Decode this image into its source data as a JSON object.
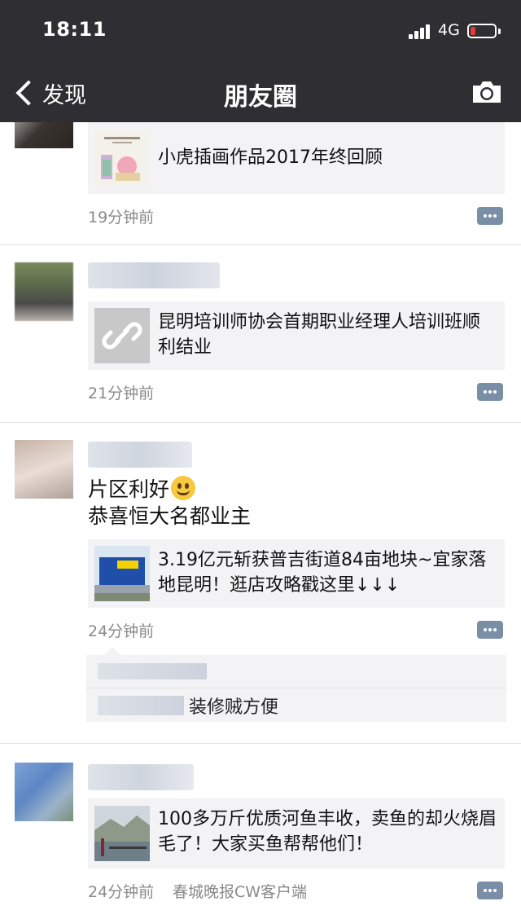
{
  "status_bar": {
    "time": "18:11",
    "network": "4G"
  },
  "nav": {
    "back_label": "发现",
    "title": "朋友圈"
  },
  "posts": [
    {
      "link_title": "小虎插画作品2017年终回顾",
      "time": "19分钟前"
    },
    {
      "link_title": "昆明培训师协会首期职业经理人培训班顺利结业",
      "time": "21分钟前"
    },
    {
      "text_lines": [
        "片区利好",
        "恭喜恒大名都业主"
      ],
      "link_title": "3.19亿元斩获普吉街道84亩地块~宜家落地昆明！逛店攻略戳这里↓↓↓",
      "time": "24分钟前",
      "comment": "装修贼方便"
    },
    {
      "link_title": "100多万斤优质河鱼丰收，卖鱼的却火烧眉毛了！大家买鱼帮帮他们！",
      "time": "24分钟前",
      "source": "春城晚报CW客户端"
    }
  ]
}
